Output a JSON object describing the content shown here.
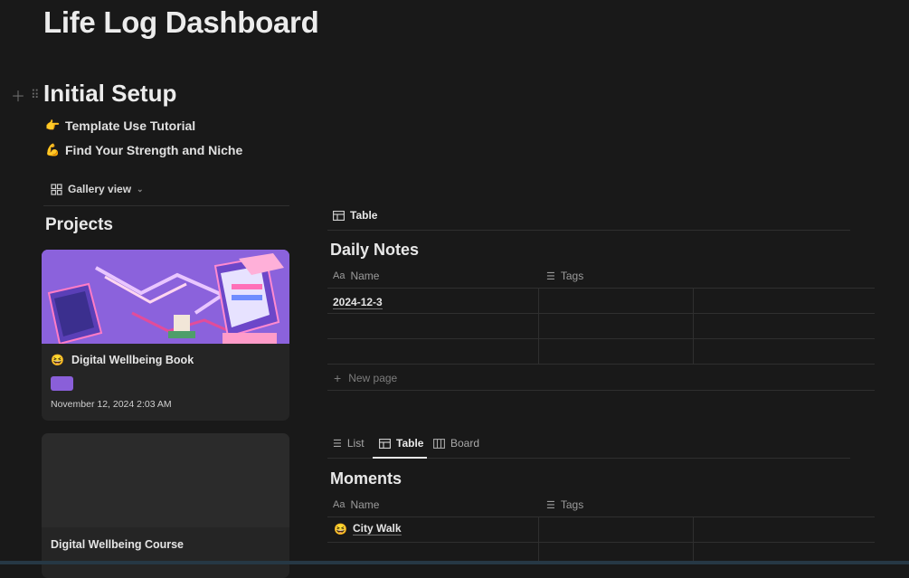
{
  "page": {
    "title": "Life Log Dashboard"
  },
  "setup": {
    "heading": "Initial Setup",
    "links": [
      {
        "emoji": "👉",
        "label": "Template Use Tutorial"
      },
      {
        "emoji": "💪",
        "label": "Find Your Strength and Niche"
      }
    ]
  },
  "projects": {
    "view_label": "Gallery view",
    "title": "Projects",
    "cards": [
      {
        "emoji": "😆",
        "name": "Digital Wellbeing Book",
        "date": "November 12, 2024 2:03 AM"
      },
      {
        "name": "Digital Wellbeing Course"
      }
    ]
  },
  "daily_notes": {
    "tab": "Table",
    "title": "Daily Notes",
    "columns": [
      {
        "prefix": "Aa",
        "label": "Name"
      },
      {
        "label": "Tags"
      }
    ],
    "rows": [
      "2024-12-3",
      "",
      ""
    ],
    "new_page": "New page"
  },
  "moments": {
    "tabs": [
      "List",
      "Table",
      "Board"
    ],
    "active_tab": "Table",
    "title": "Moments",
    "columns": [
      {
        "prefix": "Aa",
        "label": "Name"
      },
      {
        "label": "Tags"
      }
    ],
    "rows": [
      {
        "emoji": "😆",
        "name": "City Walk"
      }
    ]
  },
  "icons": [
    "plus-icon",
    "drag-handle-icon",
    "gallery-icon",
    "chevron-down-icon",
    "table-icon",
    "list-icon",
    "board-icon"
  ]
}
